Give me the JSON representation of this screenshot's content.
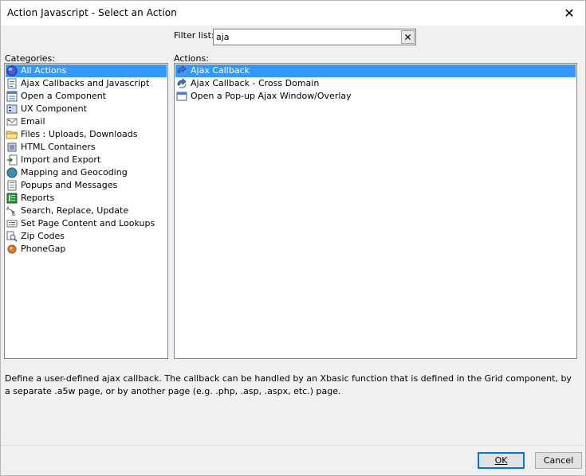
{
  "window": {
    "title": "Action Javascript - Select an Action",
    "close_glyph": "✕"
  },
  "filter": {
    "label": "Filter list:",
    "value": "aja",
    "clear_glyph": "✕"
  },
  "categories": {
    "label": "Categories:",
    "items": [
      {
        "label": "All Actions",
        "icon": "globe-icon",
        "selected": true
      },
      {
        "label": "Ajax Callbacks and Javascript",
        "icon": "ajax-page-icon"
      },
      {
        "label": "Open a Component",
        "icon": "component-icon"
      },
      {
        "label": "UX Component",
        "icon": "ux-form-icon"
      },
      {
        "label": "Email",
        "icon": "email-icon"
      },
      {
        "label": "Files : Uploads, Downloads",
        "icon": "folder-icon"
      },
      {
        "label": "HTML Containers",
        "icon": "container-icon"
      },
      {
        "label": "Import and Export",
        "icon": "import-export-icon"
      },
      {
        "label": "Mapping and Geocoding",
        "icon": "earth-icon"
      },
      {
        "label": "Popups and Messages",
        "icon": "popup-icon"
      },
      {
        "label": "Reports",
        "icon": "report-icon"
      },
      {
        "label": "Search, Replace, Update",
        "icon": "search-replace-icon"
      },
      {
        "label": "Set Page Content and Lookups",
        "icon": "lookup-icon"
      },
      {
        "label": "Zip Codes",
        "icon": "zip-search-icon"
      },
      {
        "label": "PhoneGap",
        "icon": "phonegap-icon"
      }
    ]
  },
  "actions": {
    "label": "Actions:",
    "items": [
      {
        "label": "Ajax Callback",
        "icon": "callback-arrow-icon",
        "selected": true
      },
      {
        "label": "Ajax Callback - Cross Domain",
        "icon": "callback-arrow-icon"
      },
      {
        "label": "Open a Pop-up Ajax Window/Overlay",
        "icon": "window-icon"
      }
    ]
  },
  "description": "Define a user-defined ajax callback. The callback can be handled by an Xbasic function that is defined in the Grid component, by a separate .a5w page, or by another page (e.g. .php, .asp, .aspx, etc.) page.",
  "buttons": {
    "ok": "OK",
    "cancel": "Cancel"
  },
  "colors": {
    "selection": "#3399ff",
    "window_bg": "#f0f0f0",
    "default_button_border": "#0078d7"
  }
}
